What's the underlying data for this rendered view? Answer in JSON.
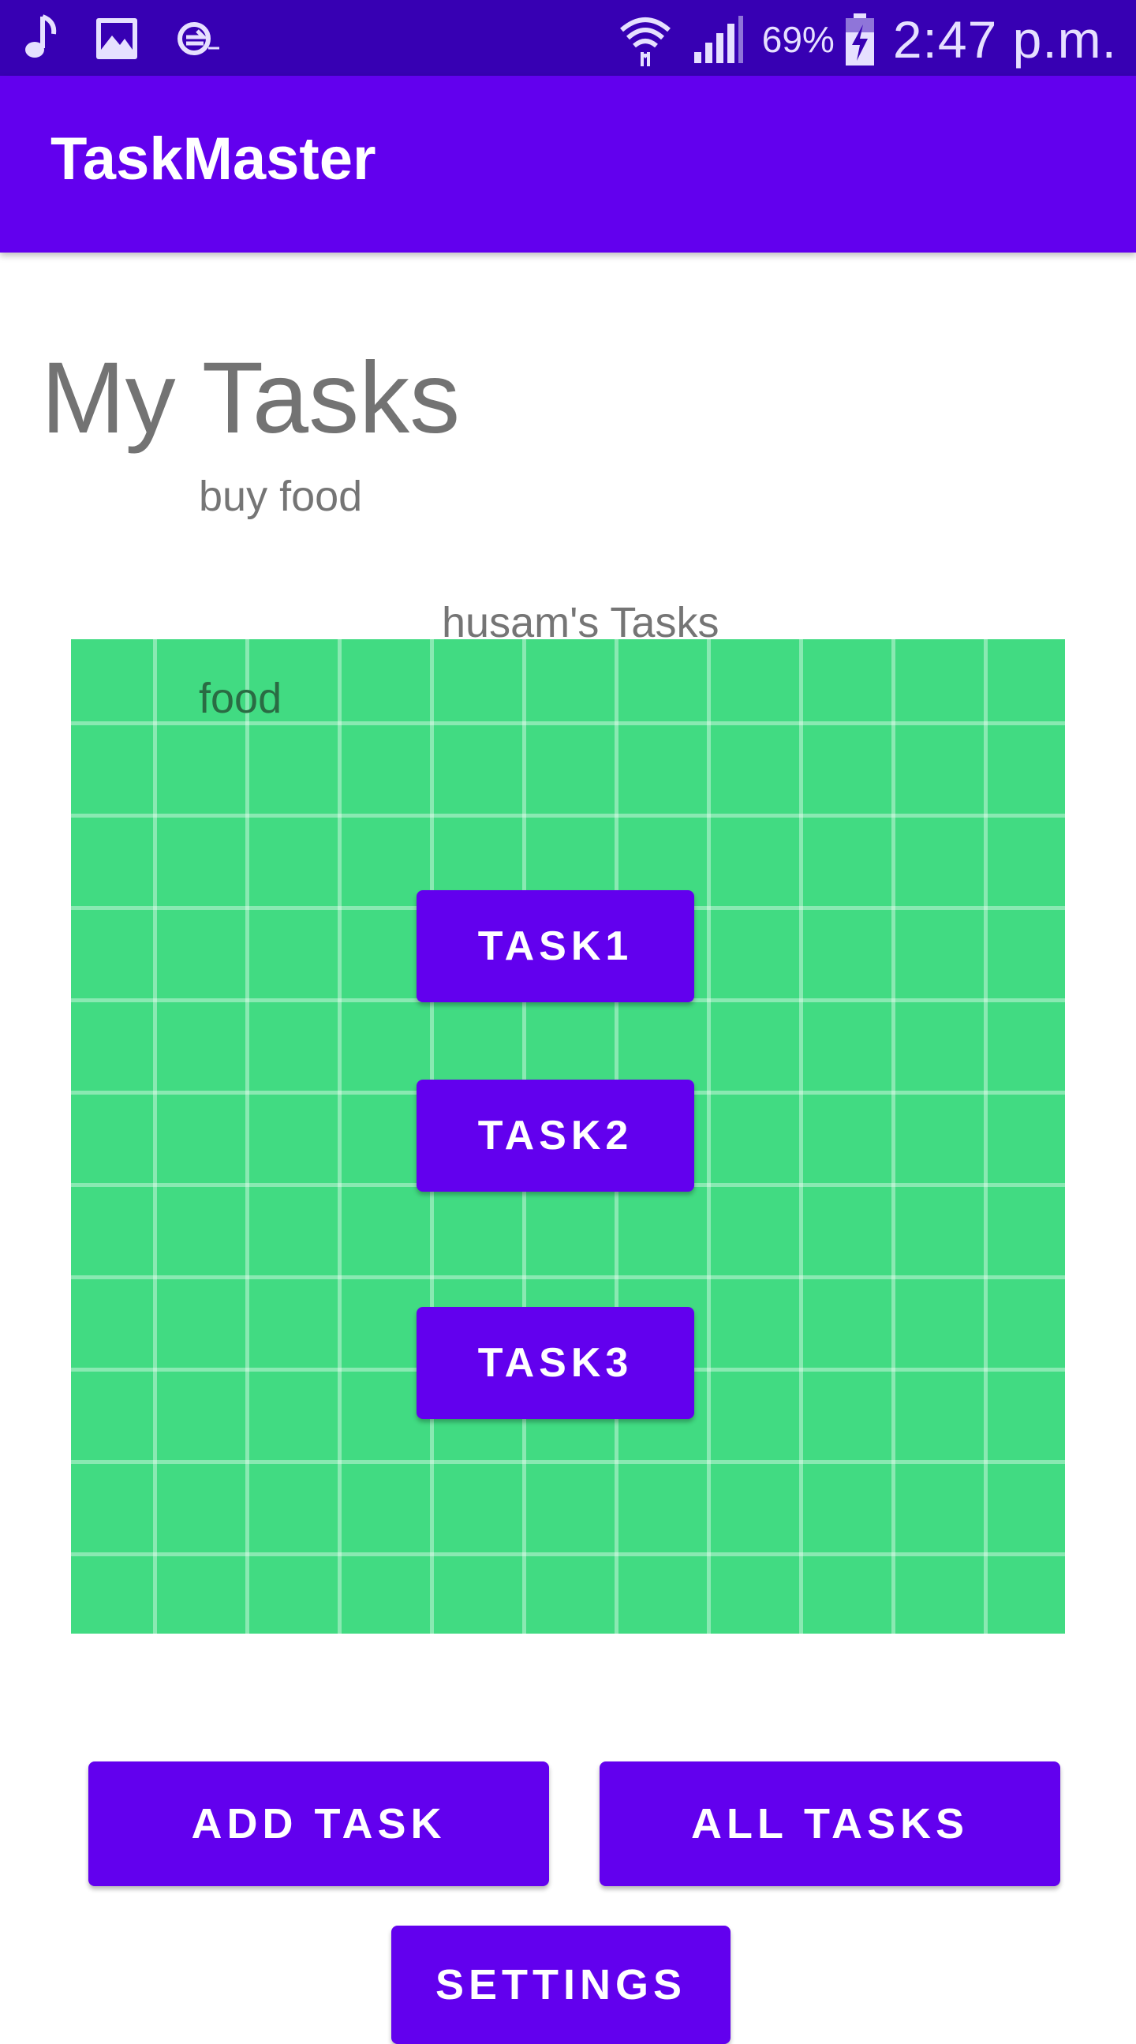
{
  "status_bar": {
    "icons": [
      "music-note-icon",
      "image-icon",
      "sync-icon",
      "wifi-icon",
      "cell-signal-icon",
      "battery-charging-icon"
    ],
    "battery_percent": "69%",
    "time": "2:47 p.m.",
    "bg_color": "#3700B3"
  },
  "app_bar": {
    "title": "TaskMaster",
    "bg_color": "#6200EE"
  },
  "main": {
    "page_title": "My Tasks",
    "sub_text": "buy food",
    "user_tasks_label": "husam's Tasks",
    "panel": {
      "bg_color": "#41DB82",
      "item": "food",
      "task_buttons": [
        "TASK1",
        "TASK2",
        "TASK3"
      ]
    },
    "actions": {
      "add_task": "ADD TASK",
      "all_tasks": "ALL TASKS",
      "settings": "SETTINGS"
    }
  }
}
